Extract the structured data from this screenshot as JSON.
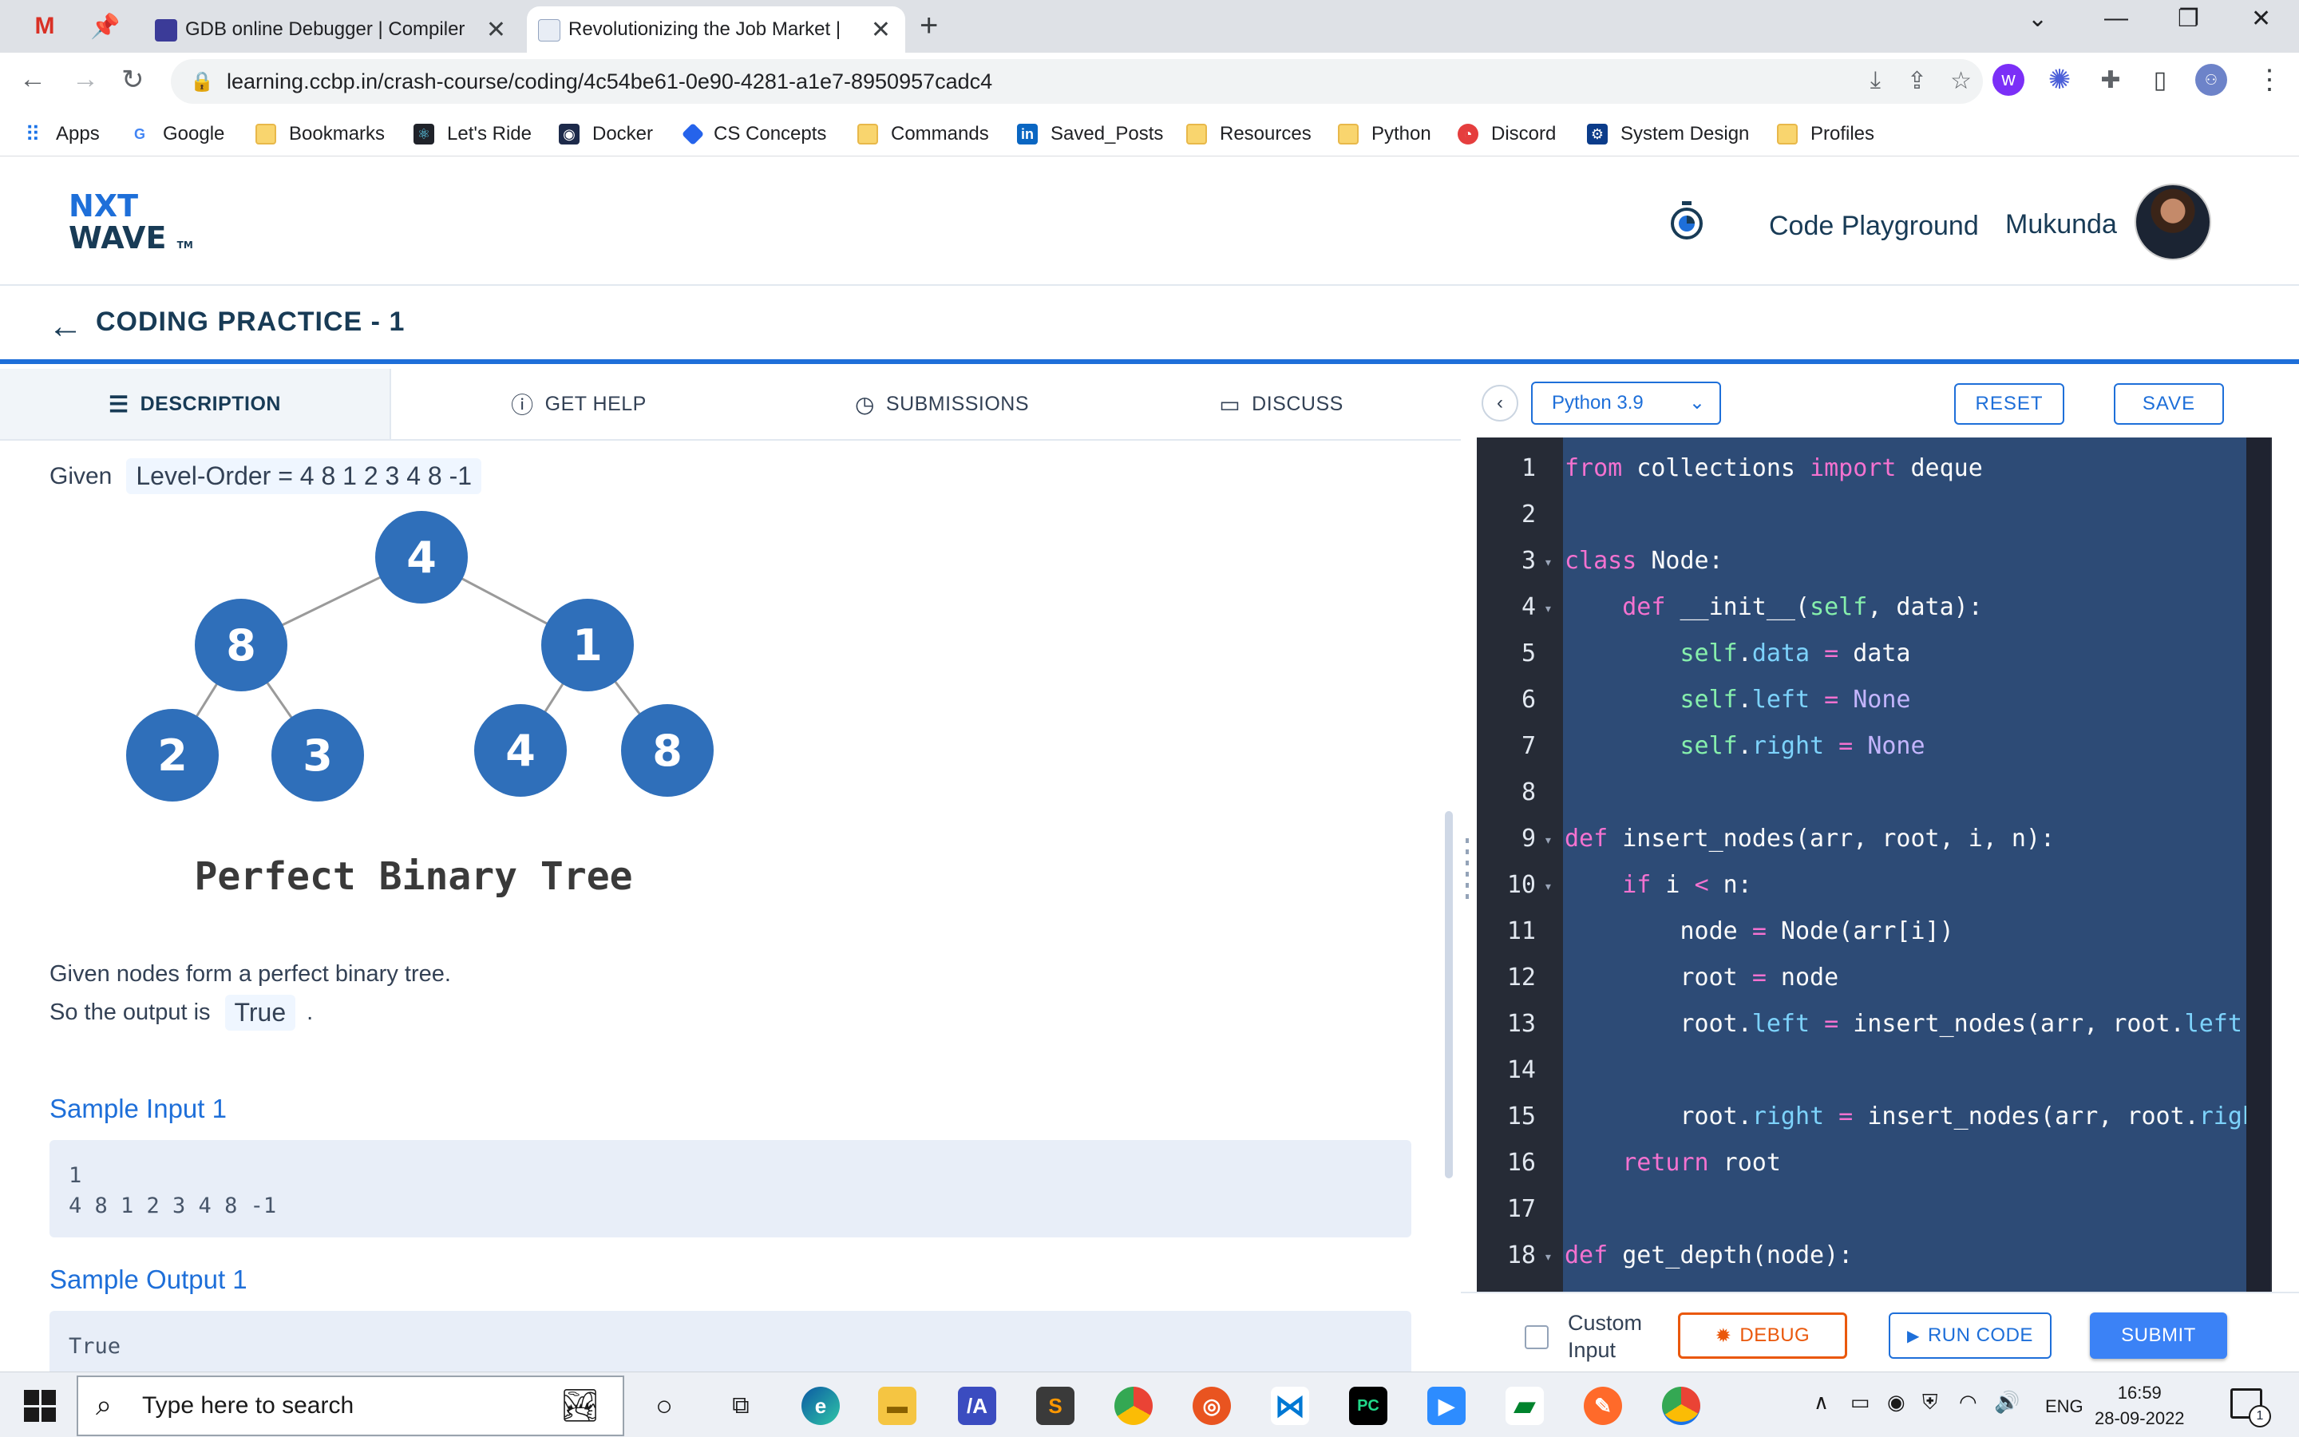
{
  "browser": {
    "tabs": [
      {
        "title": "GDB online Debugger | Compiler",
        "close": "✕"
      },
      {
        "title": "Revolutionizing the Job Market |",
        "close": "✕"
      }
    ],
    "new_tab": "+",
    "window_controls": [
      "⌄",
      "—",
      "❐",
      "✕"
    ],
    "url": "learning.ccbp.in/crash-course/coding/4c54be61-0e90-4281-a1e7-8950957cadc4",
    "bookmarks": [
      "Apps",
      "Google",
      "Bookmarks",
      "Let's Ride",
      "Docker",
      "CS Concepts",
      "Commands",
      "Saved_Posts",
      "Resources",
      "Python",
      "Discord",
      "System Design",
      "Profiles"
    ]
  },
  "header": {
    "logo_line1": "NXT",
    "logo_line2": "WAVE",
    "logo_tm": "TM",
    "playground": "Code Playground",
    "user": "Mukunda"
  },
  "breadcrumb": {
    "title": "CODING PRACTICE - 1",
    "back": "←"
  },
  "left_tabs": [
    "DESCRIPTION",
    "GET HELP",
    "SUBMISSIONS",
    "DISCUSS"
  ],
  "description": {
    "given_label": "Given",
    "given_chip": "Level-Order = 4 8 1 2 3 4 8 -1",
    "tree_nodes": [
      "4",
      "8",
      "1",
      "2",
      "3",
      "4",
      "8"
    ],
    "tree_caption": "Perfect Binary Tree",
    "para1": "Given nodes form a perfect binary tree.",
    "para2": "So the output is",
    "para2_chip": "True",
    "para2_end": ".",
    "sample_input_title": "Sample Input 1",
    "sample_input": "1\n4 8 1 2 3 4 8 -1",
    "sample_output_title": "Sample Output 1",
    "sample_output": "True"
  },
  "editor": {
    "language": "Python 3.9",
    "reset": "RESET",
    "save": "SAVE",
    "lines": [
      {
        "n": "1",
        "fold": ""
      },
      {
        "n": "2",
        "fold": ""
      },
      {
        "n": "3",
        "fold": "▾"
      },
      {
        "n": "4",
        "fold": "▾"
      },
      {
        "n": "5",
        "fold": ""
      },
      {
        "n": "6",
        "fold": ""
      },
      {
        "n": "7",
        "fold": ""
      },
      {
        "n": "8",
        "fold": ""
      },
      {
        "n": "9",
        "fold": "▾"
      },
      {
        "n": "10",
        "fold": "▾"
      },
      {
        "n": "11",
        "fold": ""
      },
      {
        "n": "12",
        "fold": ""
      },
      {
        "n": "13",
        "fold": ""
      },
      {
        "n": "14",
        "fold": ""
      },
      {
        "n": "15",
        "fold": ""
      },
      {
        "n": "16",
        "fold": ""
      },
      {
        "n": "17",
        "fold": ""
      },
      {
        "n": "18",
        "fold": "▾"
      }
    ],
    "code_tokens": [
      [
        [
          "kw",
          "from"
        ],
        [
          "fn",
          " collections "
        ],
        [
          "kw",
          "import"
        ],
        [
          "fn",
          " deque"
        ]
      ],
      [],
      [
        [
          "kw",
          "class"
        ],
        [
          "fn",
          " Node:"
        ]
      ],
      [
        [
          "fn",
          "    "
        ],
        [
          "kw",
          "def"
        ],
        [
          "fn",
          " __init__("
        ],
        [
          "sf",
          "self"
        ],
        [
          "fn",
          ", data):"
        ]
      ],
      [
        [
          "fn",
          "        "
        ],
        [
          "sf",
          "self"
        ],
        [
          "fn",
          "."
        ],
        [
          "at",
          "data"
        ],
        [
          "op",
          " = "
        ],
        [
          "fn",
          "data"
        ]
      ],
      [
        [
          "fn",
          "        "
        ],
        [
          "sf",
          "self"
        ],
        [
          "fn",
          "."
        ],
        [
          "at",
          "left"
        ],
        [
          "op",
          " = "
        ],
        [
          "nn",
          "None"
        ]
      ],
      [
        [
          "fn",
          "        "
        ],
        [
          "sf",
          "self"
        ],
        [
          "fn",
          "."
        ],
        [
          "at",
          "right"
        ],
        [
          "op",
          " = "
        ],
        [
          "nn",
          "None"
        ]
      ],
      [],
      [
        [
          "kw",
          "def"
        ],
        [
          "fn",
          " insert_nodes(arr, root, i, n):"
        ]
      ],
      [
        [
          "fn",
          "    "
        ],
        [
          "kw",
          "if"
        ],
        [
          "fn",
          " i "
        ],
        [
          "op",
          "<"
        ],
        [
          "fn",
          " n:"
        ]
      ],
      [
        [
          "fn",
          "        node "
        ],
        [
          "op",
          "="
        ],
        [
          "fn",
          " Node(arr[i])"
        ]
      ],
      [
        [
          "fn",
          "        root "
        ],
        [
          "op",
          "="
        ],
        [
          "fn",
          " node"
        ]
      ],
      [
        [
          "fn",
          "        root."
        ],
        [
          "at",
          "left"
        ],
        [
          "op",
          " = "
        ],
        [
          "fn",
          "insert_nodes(arr, root."
        ],
        [
          "at",
          "left"
        ],
        [
          "fn",
          ","
        ]
      ],
      [],
      [
        [
          "fn",
          "        root."
        ],
        [
          "at",
          "right"
        ],
        [
          "op",
          " = "
        ],
        [
          "fn",
          "insert_nodes(arr, root."
        ],
        [
          "at",
          "right"
        ]
      ],
      [
        [
          "fn",
          "    "
        ],
        [
          "kw",
          "return"
        ],
        [
          "fn",
          " root"
        ]
      ],
      [],
      [
        [
          "kw",
          "def"
        ],
        [
          "fn",
          " get_depth(node):"
        ]
      ]
    ]
  },
  "bottom": {
    "custom_input": "Custom Input",
    "debug": "DEBUG",
    "run": "RUN CODE",
    "submit": "SUBMIT"
  },
  "taskbar": {
    "search_placeholder": "Type here to search",
    "lang": "ENG",
    "time": "16:59",
    "date": "28-09-2022",
    "notif_count": "1"
  }
}
